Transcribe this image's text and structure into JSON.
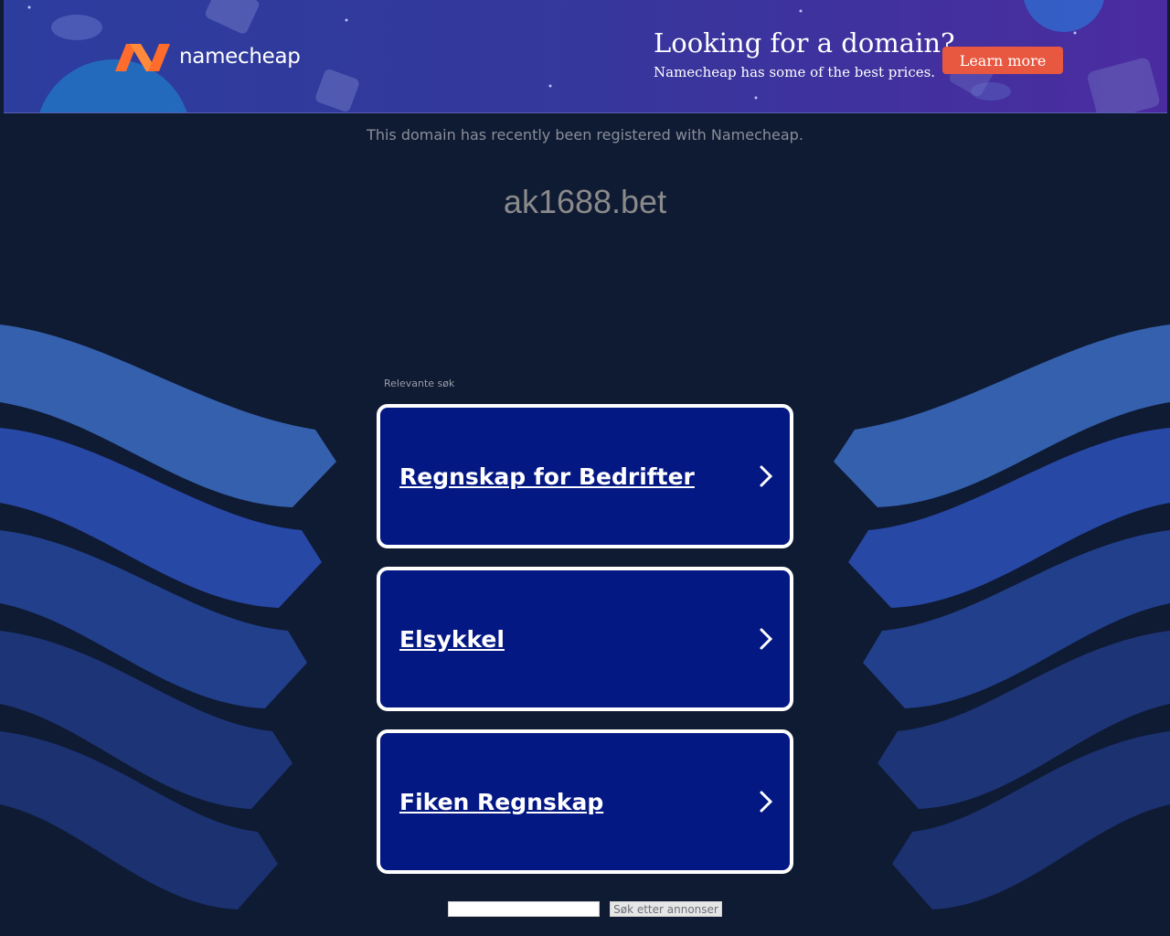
{
  "banner": {
    "brand": "namecheap",
    "promo_title": "Looking for a domain?",
    "promo_subtitle": "Namecheap has some of the best prices.",
    "cta_label": "Learn more"
  },
  "registered_note": "This domain has recently been registered with Namecheap.",
  "domain": "ak1688.bet",
  "related": {
    "label": "Relevante søk",
    "items": [
      {
        "label": "Regnskap for Bedrifter"
      },
      {
        "label": "Elsykkel"
      },
      {
        "label": "Fiken Regnskap"
      }
    ]
  },
  "search": {
    "input_value": "",
    "button_label": "Søk etter annonser"
  },
  "colors": {
    "page_background": "#0f1a33",
    "card_background": "#041884",
    "cta": "#e8573f",
    "logo_orange": "#ff6c2c"
  },
  "icons": [
    "namecheap-logo-icon",
    "chevron-right-icon"
  ]
}
